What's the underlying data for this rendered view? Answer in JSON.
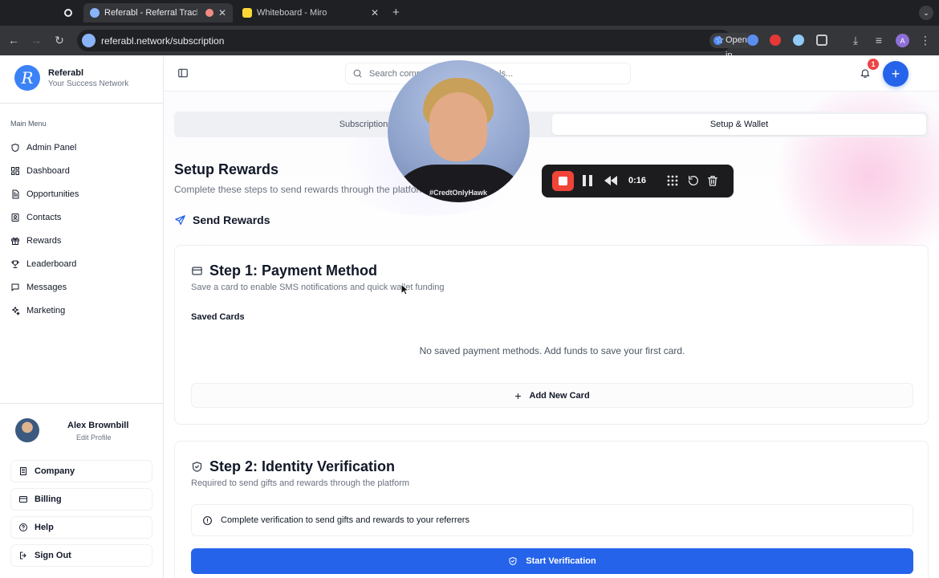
{
  "browser": {
    "tabs": [
      {
        "title": "",
        "active": false
      },
      {
        "title": "Referabl - Referral Tracking",
        "active": true
      },
      {
        "title": "Whiteboard - Miro",
        "active": false
      }
    ],
    "url": "referabl.network/subscription",
    "open_in_app_label": "Open in app",
    "profile_initial": "A"
  },
  "brand": {
    "logo_letter": "R",
    "name": "Referabl",
    "tagline": "Your Success Network"
  },
  "sidebar": {
    "menu_title": "Main Menu",
    "items": [
      {
        "label": "Admin Panel",
        "icon": "shield-icon"
      },
      {
        "label": "Dashboard",
        "icon": "grid-icon"
      },
      {
        "label": "Opportunities",
        "icon": "document-icon"
      },
      {
        "label": "Contacts",
        "icon": "contacts-icon"
      },
      {
        "label": "Rewards",
        "icon": "gift-icon"
      },
      {
        "label": "Leaderboard",
        "icon": "trophy-icon"
      },
      {
        "label": "Messages",
        "icon": "message-icon"
      },
      {
        "label": "Marketing",
        "icon": "sparkle-icon"
      }
    ],
    "profile": {
      "name": "Alex Brownbill",
      "edit_label": "Edit Profile"
    },
    "bottom": {
      "company": "Company",
      "billing": "Billing",
      "help": "Help",
      "sign_out": "Sign Out"
    }
  },
  "topbar": {
    "search_placeholder": "Search companies, deals, referrals...",
    "notification_count": "1",
    "plus_label": "+"
  },
  "tabs": {
    "subscription": "Subscription",
    "setup_wallet": "Setup & Wallet",
    "active": "setup_wallet"
  },
  "page": {
    "title": "Setup Rewards",
    "subtitle": "Complete these steps to send rewards through the platform",
    "section_title": "Send Rewards"
  },
  "step1": {
    "title": "Step 1: Payment Method",
    "subtitle": "Save a card to enable SMS notifications and quick wallet funding",
    "saved_cards_label": "Saved Cards",
    "empty_message": "No saved payment methods. Add funds to save your first card.",
    "add_card_label": "Add New Card"
  },
  "step2": {
    "title": "Step 2: Identity Verification",
    "subtitle": "Required to send gifts and rewards through the platform",
    "notice": "Complete verification to send gifts and rewards to your referrers",
    "button_label": "Start Verification"
  },
  "recorder": {
    "elapsed": "0:16",
    "shirt_text": "#CredtOnlyHawk"
  },
  "colors": {
    "accent": "#2563eb",
    "badge": "#ef4444",
    "record": "#f04438",
    "brand": "#3b82f6"
  }
}
